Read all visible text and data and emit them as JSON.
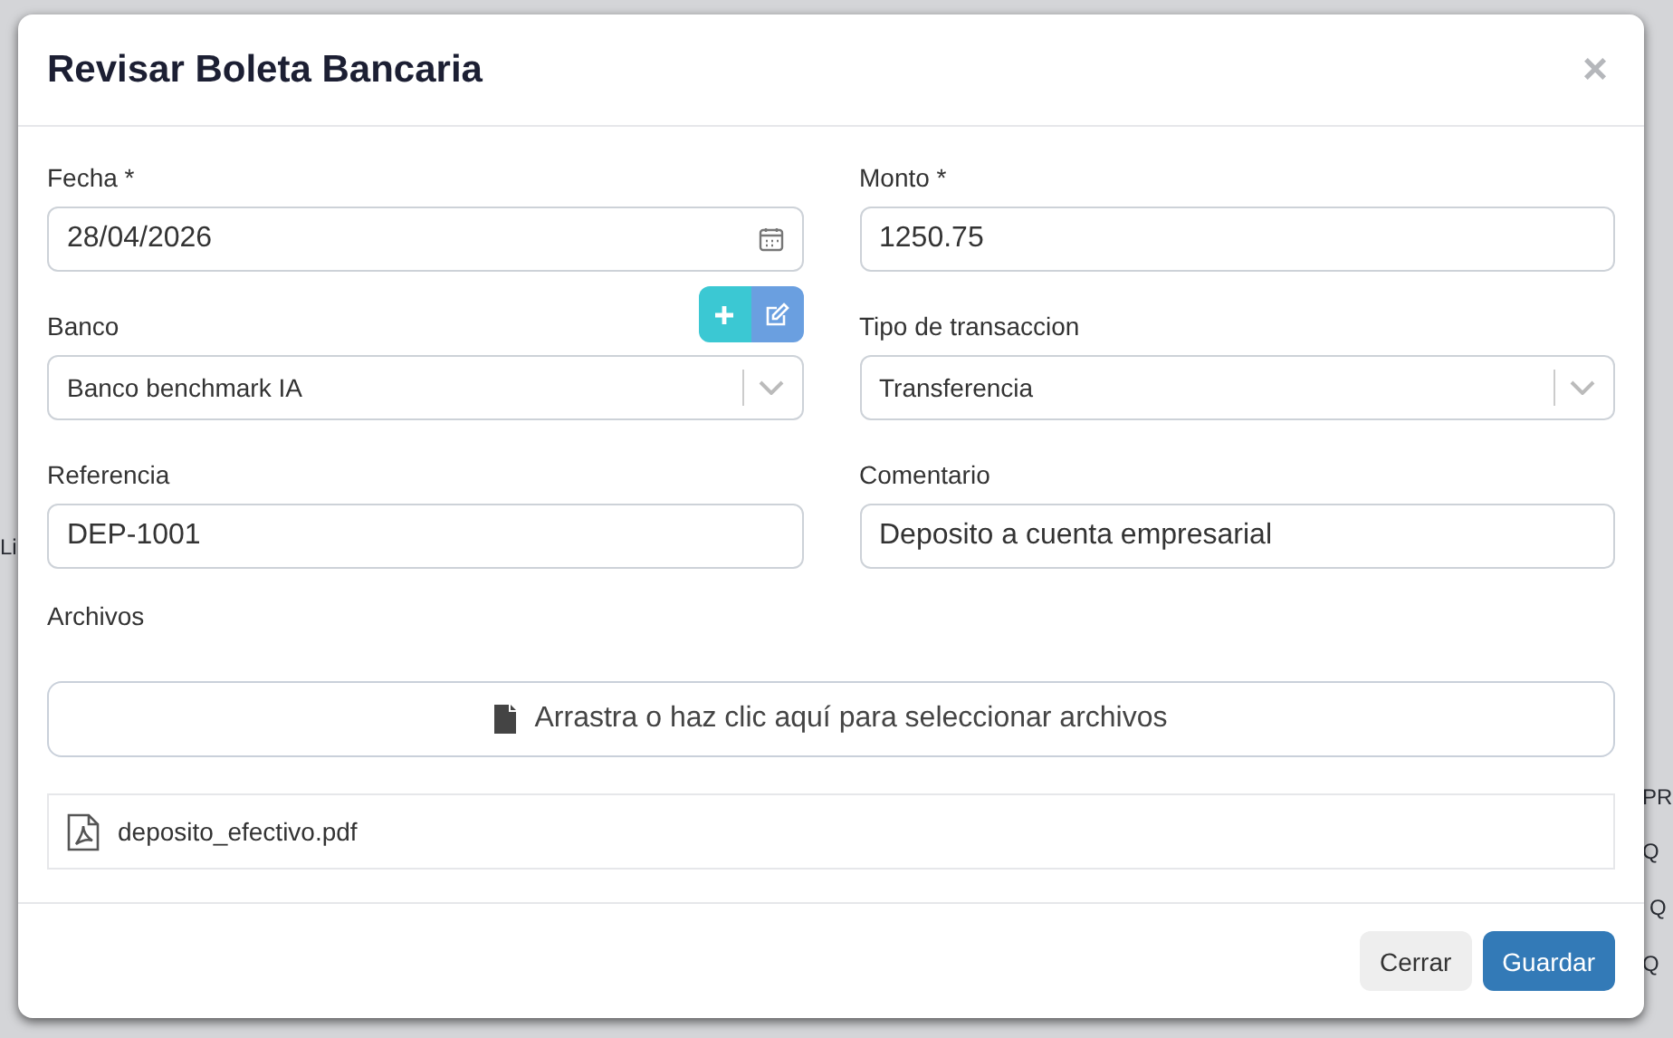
{
  "background": {
    "left_texts": [
      "Li"
    ],
    "right_texts": [
      "PR",
      "Q",
      "Q",
      "Q"
    ]
  },
  "dialog": {
    "title": "Revisar Boleta Bancaria",
    "close": "×"
  },
  "fields": [
    {
      "kind": "date",
      "label": "Fecha *",
      "value": "28/04/2026"
    },
    {
      "kind": "text",
      "label": "Monto *",
      "value": "1250.75"
    },
    {
      "kind": "select",
      "label": "Banco",
      "value": "Banco benchmark IA",
      "actions": true
    },
    {
      "kind": "select",
      "label": "Tipo de transaccion",
      "value": "Transferencia"
    },
    {
      "kind": "text",
      "label": "Referencia",
      "value": "DEP-1001"
    },
    {
      "kind": "text",
      "label": "Comentario",
      "value": "Deposito a cuenta empresarial"
    }
  ],
  "files": {
    "label": "Archivos",
    "dropzone": "Arrastra o haz clic aquí para seleccionar archivos",
    "items": [
      {
        "name": "deposito_efectivo.pdf"
      }
    ]
  },
  "buttons": [
    {
      "label": "Cerrar",
      "kind": "secondary"
    },
    {
      "label": "Guardar",
      "kind": "primary"
    }
  ]
}
